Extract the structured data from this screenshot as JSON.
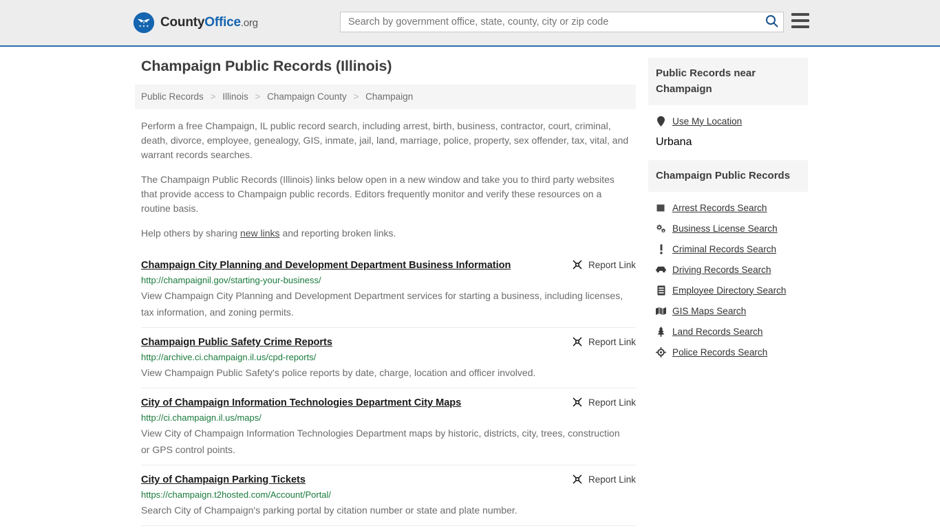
{
  "header": {
    "brand": {
      "part1": "County",
      "part2": "Office",
      "suffix": ".org"
    },
    "search": {
      "placeholder": "Search by government office, state, county, city or zip code",
      "value": "",
      "icon": "search-icon"
    },
    "menu_icon": "hamburger-menu-icon",
    "accent_color": "#2b6cb0",
    "background_color": "#ededed"
  },
  "page": {
    "title": "Champaign Public Records (Illinois)",
    "breadcrumb": [
      {
        "label": "Public Records"
      },
      {
        "label": "Illinois"
      },
      {
        "label": "Champaign County"
      },
      {
        "label": "Champaign"
      }
    ],
    "breadcrumb_separator": ">",
    "intro_paragraph_1": "Perform a free Champaign, IL public record search, including arrest, birth, business, contractor, court, criminal, death, divorce, employee, genealogy, GIS, inmate, jail, land, marriage, police, property, sex offender, tax, vital, and warrant records searches.",
    "intro_paragraph_2": "The Champaign Public Records (Illinois) links below open in a new window and take you to third party websites that provide access to Champaign public records. Editors frequently monitor and verify these resources on a routine basis.",
    "help_prefix": "Help others by sharing ",
    "help_link": "new links",
    "help_suffix": " and reporting broken links."
  },
  "listings": [
    {
      "title": "Champaign City Planning and Development Department Business Information",
      "url": "http://champaignil.gov/starting-your-business/",
      "description": "View Champaign City Planning and Development Department services for starting a business, including licenses, tax information, and zoning permits.",
      "report_label": "Report Link",
      "report_icon": "broken-link-icon"
    },
    {
      "title": "Champaign Public Safety Crime Reports",
      "url": "http://archive.ci.champaign.il.us/cpd-reports/",
      "description": "View Champaign Public Safety's police reports by date, charge, location and officer involved.",
      "report_label": "Report Link",
      "report_icon": "broken-link-icon"
    },
    {
      "title": "City of Champaign Information Technologies Department City Maps",
      "url": "http://ci.champaign.il.us/maps/",
      "description": "View City of Champaign Information Technologies Department maps by historic, districts, city, trees, construction or GPS control points.",
      "report_label": "Report Link",
      "report_icon": "broken-link-icon"
    },
    {
      "title": "City of Champaign Parking Tickets",
      "url": "https://champaign.t2hosted.com/Account/Portal/",
      "description": "Search City of Champaign's parking portal by citation number or state and plate number.",
      "report_label": "Report Link",
      "report_icon": "broken-link-icon"
    }
  ],
  "sidebar": {
    "nearby": {
      "heading": "Public Records near Champaign",
      "items": [
        {
          "label": "Use My Location",
          "icon": "map-pin-icon"
        },
        {
          "label": "Urbana",
          "icon": "none"
        }
      ]
    },
    "records": {
      "heading": "Champaign Public Records",
      "items": [
        {
          "label": "Arrest Records Search",
          "icon": "square-icon"
        },
        {
          "label": "Business License Search",
          "icon": "cogs-icon"
        },
        {
          "label": "Criminal Records Search",
          "icon": "exclamation-icon"
        },
        {
          "label": "Driving Records Search",
          "icon": "car-icon"
        },
        {
          "label": "Employee Directory Search",
          "icon": "id-card-icon"
        },
        {
          "label": "GIS Maps Search",
          "icon": "map-icon"
        },
        {
          "label": "Land Records Search",
          "icon": "tree-icon"
        },
        {
          "label": "Police Records Search",
          "icon": "police-badge-icon"
        }
      ]
    }
  },
  "colors": {
    "url_green": "#1a7a3c",
    "text_gray": "#6b6b6b",
    "heading_gray": "#3d3d3d",
    "panel_gray": "#f5f5f5"
  }
}
